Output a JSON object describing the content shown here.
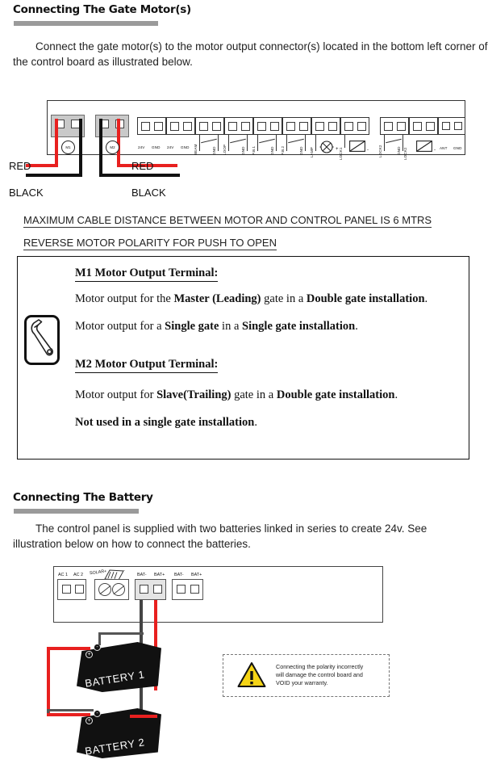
{
  "sections": {
    "motor": {
      "heading": "Connecting The Gate Motor(s)",
      "paragraph": "Connect the gate motor(s) to the motor output connector(s) located in the bottom left corner of the control board as illustrated below.",
      "notes": [
        "MAXIMUM CABLE DISTANCE BETWEEN MOTOR AND CONTROL PANEL IS 6 MTRS",
        "REVERSE MOTOR POLARITY FOR PUSH TO OPEN"
      ]
    },
    "battery": {
      "heading": "Connecting The Battery",
      "paragraph": "The control panel is supplied with two batteries linked in series to create 24v. See illustration below on how to connect the batteries."
    }
  },
  "board_diagram": {
    "motor_terminals": [
      {
        "id": "M1",
        "circle_label": "M1"
      },
      {
        "id": "M2",
        "circle_label": "M2"
      }
    ],
    "wire_labels": [
      {
        "color_name": "RED",
        "color_hex": "#e8201f"
      },
      {
        "color_name": "BLACK",
        "color_hex": "#111111"
      },
      {
        "color_name": "RED",
        "color_hex": "#e8201f"
      },
      {
        "color_name": "BLACK",
        "color_hex": "#111111"
      }
    ],
    "terminal_blocks": [
      {
        "labels": [
          "24V",
          "GND"
        ],
        "rotated": false
      },
      {
        "labels": [
          "24V",
          "GND"
        ],
        "rotated": false
      },
      {
        "labels": [
          "BEAM",
          "GND"
        ],
        "rotated": true
      },
      {
        "labels": [
          "LOOP",
          "GND"
        ],
        "rotated": true
      },
      {
        "labels": [
          "P.B.1",
          "GND"
        ],
        "rotated": true
      },
      {
        "labels": [
          "P.B.2",
          "GND"
        ],
        "rotated": true
      },
      {
        "labels": [
          "LAMP"
        ],
        "rotated": true,
        "symbol": "lamp"
      },
      {
        "labels": [
          "LOCK1"
        ],
        "rotated": true,
        "symbol": "lock",
        "polarity": [
          "+",
          "-"
        ]
      },
      {
        "labels": [
          "LOCK2",
          "GND"
        ],
        "rotated": true
      },
      {
        "labels": [
          "LOCK2"
        ],
        "rotated": true,
        "symbol": "lock",
        "polarity": [
          "+",
          "-"
        ]
      },
      {
        "labels": [
          "ANT",
          "GND"
        ],
        "rotated": false
      }
    ]
  },
  "info_box": {
    "icon": "wrench-icon",
    "entries": [
      {
        "title": "M1 Motor Output Terminal: ",
        "lines": [
          [
            {
              "t": "Motor output for the ",
              "b": false
            },
            {
              "t": "Master (Leading)",
              "b": true
            },
            {
              "t": " gate in a ",
              "b": false
            },
            {
              "t": "Double gate installation",
              "b": true
            },
            {
              "t": ".",
              "b": false
            }
          ],
          [
            {
              "t": "Motor output for a ",
              "b": false
            },
            {
              "t": "Single gate",
              "b": true
            },
            {
              "t": " in a ",
              "b": false
            },
            {
              "t": "Single gate installation",
              "b": true
            },
            {
              "t": ".",
              "b": false
            }
          ]
        ]
      },
      {
        "title": "M2 Motor Output Terminal: ",
        "lines": [
          [
            {
              "t": "Motor output for ",
              "b": false
            },
            {
              "t": "Slave(Trailing)",
              "b": true
            },
            {
              "t": " gate in a ",
              "b": false
            },
            {
              "t": "Double gate installation",
              "b": true
            },
            {
              "t": ".",
              "b": false
            }
          ],
          [
            {
              "t": "Not used in a single gate installation",
              "b": true
            },
            {
              "t": ".",
              "b": false
            }
          ]
        ]
      }
    ]
  },
  "battery_diagram": {
    "board_terminals": [
      {
        "labels": [
          "AC 1",
          "AC 2"
        ],
        "kind": "plain"
      },
      {
        "labels": [
          "SOLAR+",
          "-"
        ],
        "kind": "solar"
      },
      {
        "labels": [
          "BAT-",
          "BAT+"
        ],
        "kind": "highlighted"
      },
      {
        "labels": [
          "BAT-",
          "BAT+"
        ],
        "kind": "plain"
      }
    ],
    "batteries": [
      {
        "name": "BATTERY 1",
        "terminals": [
          "-",
          "+"
        ]
      },
      {
        "name": "BATTERY 2",
        "terminals": [
          "-",
          "+"
        ]
      }
    ],
    "warning": {
      "icon": "warning-triangle-icon",
      "text": "Connecting the polarity incorrectly will damage the control board and VOID your warranty.",
      "lines": [
        "Connecting the polarity incorrectly",
        "will damage the control board and",
        "VOID your warranty."
      ],
      "color_hex": "#f5d416"
    }
  },
  "colors": {
    "rule_grey": "#9a9a9a",
    "wire_red": "#e8201f",
    "wire_black": "#111111",
    "warning_yellow": "#f5d416"
  }
}
